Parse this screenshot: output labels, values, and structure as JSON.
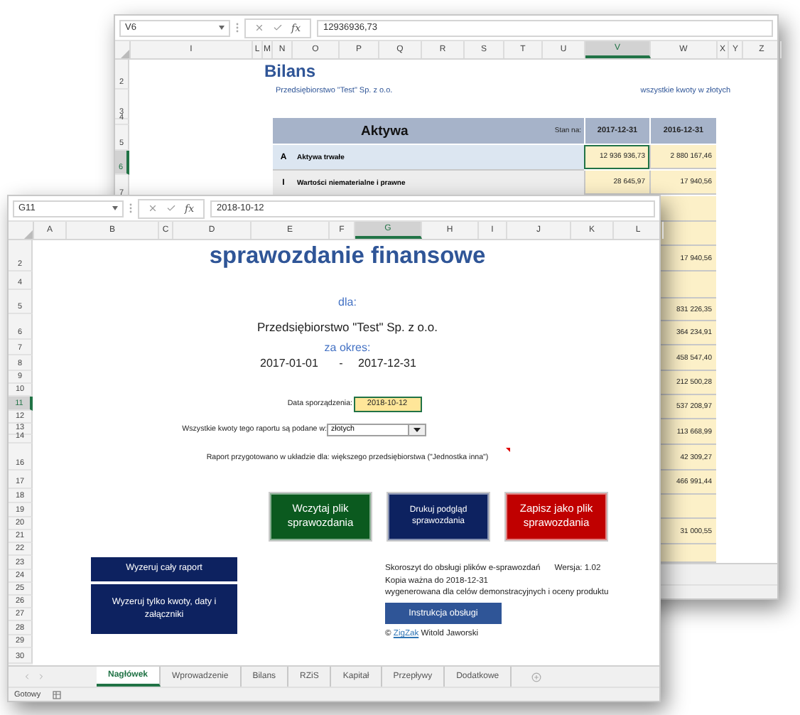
{
  "back_window": {
    "formula_bar": {
      "name_box": "V6",
      "fx": "fx",
      "formula": "12936936,73"
    },
    "columns": [
      {
        "label": "I",
        "selected": false
      },
      {
        "label": "L",
        "selected": false
      },
      {
        "label": "M",
        "selected": false
      },
      {
        "label": "N",
        "selected": false
      },
      {
        "label": "O",
        "selected": false
      },
      {
        "label": "P",
        "selected": false
      },
      {
        "label": "Q",
        "selected": false
      },
      {
        "label": "R",
        "selected": false
      },
      {
        "label": "S",
        "selected": false
      },
      {
        "label": "T",
        "selected": false
      },
      {
        "label": "U",
        "selected": false
      },
      {
        "label": "V",
        "selected": true
      },
      {
        "label": "W",
        "selected": false
      },
      {
        "label": "X",
        "selected": false
      },
      {
        "label": "Y",
        "selected": false
      },
      {
        "label": "Z",
        "selected": false
      }
    ],
    "rows": [
      {
        "label": "2",
        "selected": false
      },
      {
        "label": "3",
        "selected": false
      },
      {
        "label": "4",
        "selected": false
      },
      {
        "label": "5",
        "selected": false
      },
      {
        "label": "6",
        "selected": true
      },
      {
        "label": "7",
        "selected": false
      }
    ],
    "title": "Bilans",
    "company": "Przedsiębiorstwo \"Test\" Sp. z o.o.",
    "note": "wszystkie kwoty w złotych",
    "table": {
      "heading": "Aktywa",
      "date_label": "Stan na:",
      "dates": [
        "2017-12-31",
        "2016-12-31"
      ],
      "rows": [
        {
          "kind": "section",
          "code": "A",
          "label": "Aktywa trwałe",
          "values": [
            {
              "text": "12 936 936,73",
              "selected": true
            },
            {
              "text": "2 880 167,46",
              "selected": false
            }
          ]
        },
        {
          "kind": "group",
          "code": "I",
          "label": "Wartości niematerialne i prawne",
          "values": [
            {
              "text": "28 645,97",
              "selected": false
            },
            {
              "text": "17 940,56",
              "selected": false
            }
          ]
        },
        {
          "kind": "covered"
        },
        {
          "kind": "covered"
        },
        {
          "kind": "covered",
          "visible_value": "17 940,56"
        },
        {
          "kind": "covered"
        },
        {
          "kind": "covered",
          "visible_value": "831 226,35"
        },
        {
          "kind": "covered",
          "visible_value": "364 234,91"
        },
        {
          "kind": "covered",
          "visible_value": "458 547,40"
        },
        {
          "kind": "covered",
          "visible_value": "212 500,28"
        },
        {
          "kind": "covered",
          "visible_value": "537 208,97"
        },
        {
          "kind": "covered",
          "visible_value": "113 668,99"
        },
        {
          "kind": "covered",
          "visible_value": "42 309,27"
        },
        {
          "kind": "covered",
          "visible_value": "466 991,44"
        },
        {
          "kind": "covered"
        },
        {
          "kind": "covered",
          "visible_value": "31 000,55"
        },
        {
          "kind": "covered"
        }
      ]
    }
  },
  "front_window": {
    "formula_bar": {
      "name_box": "G11",
      "fx": "fx",
      "formula": "2018-10-12"
    },
    "columns": [
      {
        "label": "A",
        "selected": false
      },
      {
        "label": "B",
        "selected": false
      },
      {
        "label": "C",
        "selected": false
      },
      {
        "label": "D",
        "selected": false
      },
      {
        "label": "E",
        "selected": false
      },
      {
        "label": "F",
        "selected": false
      },
      {
        "label": "G",
        "selected": true
      },
      {
        "label": "H",
        "selected": false
      },
      {
        "label": "I",
        "selected": false
      },
      {
        "label": "J",
        "selected": false
      },
      {
        "label": "K",
        "selected": false
      },
      {
        "label": "L",
        "selected": false
      }
    ],
    "rows": [
      {
        "label": "2",
        "selected": false
      },
      {
        "label": "4",
        "selected": false
      },
      {
        "label": "5",
        "selected": false
      },
      {
        "label": "6",
        "selected": false
      },
      {
        "label": "7",
        "selected": false
      },
      {
        "label": "8",
        "selected": false
      },
      {
        "label": "9",
        "selected": false
      },
      {
        "label": "10",
        "selected": false
      },
      {
        "label": "11",
        "selected": true
      },
      {
        "label": "12",
        "selected": false
      },
      {
        "label": "13",
        "selected": false
      },
      {
        "label": "14",
        "selected": false
      },
      {
        "label": "16",
        "selected": false
      },
      {
        "label": "17",
        "selected": false
      },
      {
        "label": "18",
        "selected": false
      },
      {
        "label": "19",
        "selected": false
      },
      {
        "label": "20",
        "selected": false
      },
      {
        "label": "21",
        "selected": false
      },
      {
        "label": "22",
        "selected": false
      },
      {
        "label": "23",
        "selected": false
      },
      {
        "label": "24",
        "selected": false
      },
      {
        "label": "25",
        "selected": false
      },
      {
        "label": "26",
        "selected": false
      },
      {
        "label": "27",
        "selected": false
      },
      {
        "label": "28",
        "selected": false
      },
      {
        "label": "29",
        "selected": false
      },
      {
        "label": "30",
        "selected": false
      }
    ],
    "title": "sprawozdanie finansowe",
    "for_label": "dla:",
    "company": "Przedsiębiorstwo \"Test\" Sp. z o.o.",
    "period_label": "za okres:",
    "period": {
      "start": "2017-01-01",
      "separator": "-",
      "end": "2017-12-31"
    },
    "date_field": {
      "label": "Data sporządzenia:",
      "value": "2018-10-12"
    },
    "currency_field": {
      "label": "Wszystkie kwoty tego raportu są podane w:",
      "value": "złotych"
    },
    "layout_note": {
      "text": "Raport przygotowano w układzie dla:  większego przedsiębiorstwa (\"Jednostka inna\")",
      "has_comment": true
    },
    "buttons": [
      {
        "label": "Wczytaj plik sprawozdania",
        "color": "#0b5a1f",
        "kind": "large"
      },
      {
        "label": "Drukuj podgląd sprawozdania",
        "color": "#0d2260",
        "kind": "small"
      },
      {
        "label": "Zapisz jako plik sprawozdania",
        "color": "#c00000",
        "kind": "large"
      }
    ],
    "reset_buttons": [
      "Wyzeruj  cały raport",
      "Wyzeruj tylko kwoty, daty i załączniki"
    ],
    "info": {
      "lines": [
        "Skoroszyt do obsługi plików e-sprawozdań",
        "Kopia ważna do 2018-12-31",
        "wygenerowana dla celów demonstracyjnych i oceny produktu"
      ],
      "version": "Wersja: 1.02"
    },
    "help_button": "Instrukcja obsługi",
    "copyright": {
      "symbol": "©",
      "link": "ZigZak",
      "author": "Witold Jaworski"
    },
    "tabs": [
      {
        "label": "Nagłówek",
        "selected": true
      },
      {
        "label": "Wprowadzenie",
        "selected": false
      },
      {
        "label": "Bilans",
        "selected": false
      },
      {
        "label": "RZiS",
        "selected": false
      },
      {
        "label": "Kapitał",
        "selected": false
      },
      {
        "label": "Przepływy",
        "selected": false
      },
      {
        "label": "Dodatkowe",
        "selected": false
      }
    ],
    "status": "Gotowy"
  }
}
